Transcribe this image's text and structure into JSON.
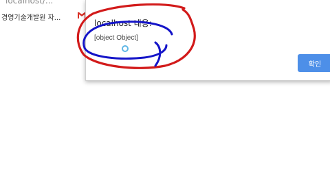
{
  "browser": {
    "url_fragment": "localhost/...",
    "bookmark_label": "경영기술개발원 자..."
  },
  "dialog": {
    "title": "localhost 내용:",
    "message": "[object Object]",
    "ok_label": "확인"
  },
  "colors": {
    "ok_button": "#4d8fe8",
    "annotation_red": "#d21a1a",
    "annotation_blue": "#1414c8"
  },
  "icons": {
    "bookmark_icon": "gmail-icon"
  }
}
